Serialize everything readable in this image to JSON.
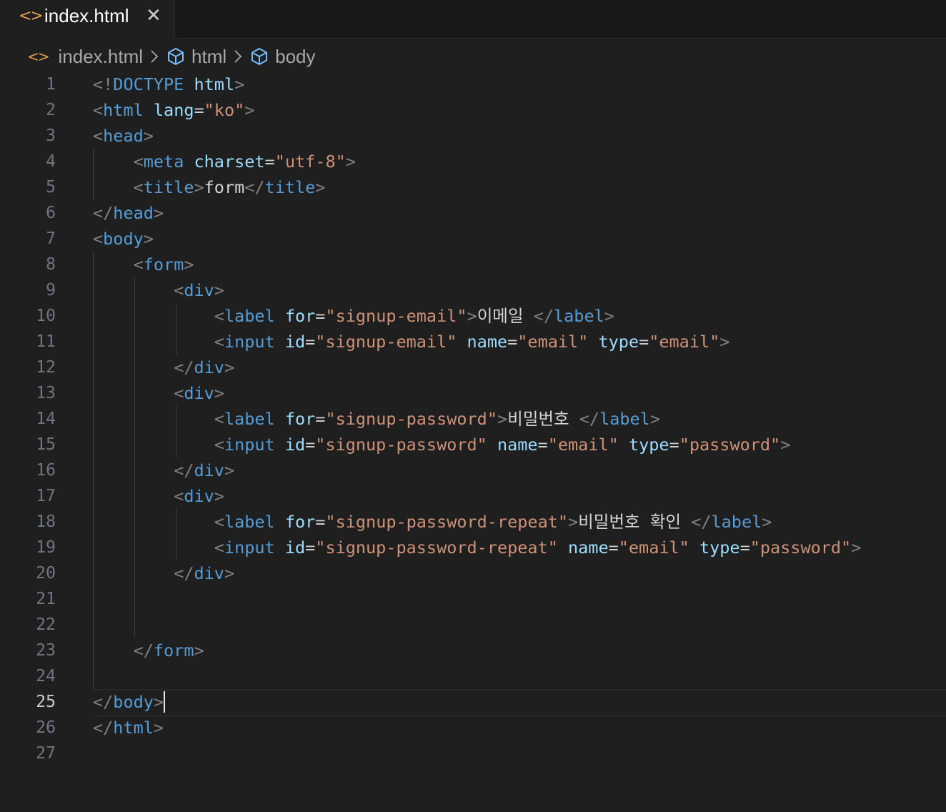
{
  "tab": {
    "label": "index.html",
    "icon": "html-file-icon",
    "close": "✕"
  },
  "breadcrumb": {
    "items": [
      "index.html",
      "html",
      "body"
    ]
  },
  "editor": {
    "active_line": 25,
    "lines": [
      {
        "n": "1",
        "tokens": [
          {
            "t": "p",
            "v": "<!"
          },
          {
            "t": "tag",
            "v": "DOCTYPE"
          },
          {
            "t": "w",
            "v": " "
          },
          {
            "t": "attr",
            "v": "html"
          },
          {
            "t": "p",
            "v": ">"
          }
        ]
      },
      {
        "n": "2",
        "tokens": [
          {
            "t": "p",
            "v": "<"
          },
          {
            "t": "tag",
            "v": "html"
          },
          {
            "t": "w",
            "v": " "
          },
          {
            "t": "attr",
            "v": "lang"
          },
          {
            "t": "eq",
            "v": "="
          },
          {
            "t": "str",
            "v": "\"ko\""
          },
          {
            "t": "p",
            "v": ">"
          }
        ]
      },
      {
        "n": "3",
        "tokens": [
          {
            "t": "p",
            "v": "<"
          },
          {
            "t": "tag",
            "v": "head"
          },
          {
            "t": "p",
            "v": ">"
          }
        ]
      },
      {
        "n": "4",
        "tokens": [
          {
            "t": "w",
            "v": "    "
          },
          {
            "t": "p",
            "v": "<"
          },
          {
            "t": "tag",
            "v": "meta"
          },
          {
            "t": "w",
            "v": " "
          },
          {
            "t": "attr",
            "v": "charset"
          },
          {
            "t": "eq",
            "v": "="
          },
          {
            "t": "str",
            "v": "\"utf-8\""
          },
          {
            "t": "p",
            "v": ">"
          }
        ]
      },
      {
        "n": "5",
        "tokens": [
          {
            "t": "w",
            "v": "    "
          },
          {
            "t": "p",
            "v": "<"
          },
          {
            "t": "tag",
            "v": "title"
          },
          {
            "t": "p",
            "v": ">"
          },
          {
            "t": "text",
            "v": "form"
          },
          {
            "t": "p",
            "v": "</"
          },
          {
            "t": "tag",
            "v": "title"
          },
          {
            "t": "p",
            "v": ">"
          }
        ]
      },
      {
        "n": "6",
        "tokens": [
          {
            "t": "p",
            "v": "</"
          },
          {
            "t": "tag",
            "v": "head"
          },
          {
            "t": "p",
            "v": ">"
          }
        ]
      },
      {
        "n": "7",
        "tokens": [
          {
            "t": "p",
            "v": "<"
          },
          {
            "t": "tag",
            "v": "body"
          },
          {
            "t": "p",
            "v": ">"
          }
        ]
      },
      {
        "n": "8",
        "tokens": [
          {
            "t": "w",
            "v": "    "
          },
          {
            "t": "p",
            "v": "<"
          },
          {
            "t": "tag",
            "v": "form"
          },
          {
            "t": "p",
            "v": ">"
          }
        ]
      },
      {
        "n": "9",
        "tokens": [
          {
            "t": "w",
            "v": "        "
          },
          {
            "t": "p",
            "v": "<"
          },
          {
            "t": "tag",
            "v": "div"
          },
          {
            "t": "p",
            "v": ">"
          }
        ]
      },
      {
        "n": "10",
        "tokens": [
          {
            "t": "w",
            "v": "            "
          },
          {
            "t": "p",
            "v": "<"
          },
          {
            "t": "tag",
            "v": "label"
          },
          {
            "t": "w",
            "v": " "
          },
          {
            "t": "attr",
            "v": "for"
          },
          {
            "t": "eq",
            "v": "="
          },
          {
            "t": "str",
            "v": "\"signup-email\""
          },
          {
            "t": "p",
            "v": ">"
          },
          {
            "t": "text",
            "v": "이메일 "
          },
          {
            "t": "p",
            "v": "</"
          },
          {
            "t": "tag",
            "v": "label"
          },
          {
            "t": "p",
            "v": ">"
          }
        ]
      },
      {
        "n": "11",
        "tokens": [
          {
            "t": "w",
            "v": "            "
          },
          {
            "t": "p",
            "v": "<"
          },
          {
            "t": "tag",
            "v": "input"
          },
          {
            "t": "w",
            "v": " "
          },
          {
            "t": "attr",
            "v": "id"
          },
          {
            "t": "eq",
            "v": "="
          },
          {
            "t": "str",
            "v": "\"signup-email\""
          },
          {
            "t": "w",
            "v": " "
          },
          {
            "t": "attr",
            "v": "name"
          },
          {
            "t": "eq",
            "v": "="
          },
          {
            "t": "str",
            "v": "\"email\""
          },
          {
            "t": "w",
            "v": " "
          },
          {
            "t": "attr",
            "v": "type"
          },
          {
            "t": "eq",
            "v": "="
          },
          {
            "t": "str",
            "v": "\"email\""
          },
          {
            "t": "p",
            "v": ">"
          }
        ]
      },
      {
        "n": "12",
        "tokens": [
          {
            "t": "w",
            "v": "        "
          },
          {
            "t": "p",
            "v": "</"
          },
          {
            "t": "tag",
            "v": "div"
          },
          {
            "t": "p",
            "v": ">"
          }
        ]
      },
      {
        "n": "13",
        "tokens": [
          {
            "t": "w",
            "v": "        "
          },
          {
            "t": "p",
            "v": "<"
          },
          {
            "t": "tag",
            "v": "div"
          },
          {
            "t": "p",
            "v": ">"
          }
        ]
      },
      {
        "n": "14",
        "tokens": [
          {
            "t": "w",
            "v": "            "
          },
          {
            "t": "p",
            "v": "<"
          },
          {
            "t": "tag",
            "v": "label"
          },
          {
            "t": "w",
            "v": " "
          },
          {
            "t": "attr",
            "v": "for"
          },
          {
            "t": "eq",
            "v": "="
          },
          {
            "t": "str",
            "v": "\"signup-password\""
          },
          {
            "t": "p",
            "v": ">"
          },
          {
            "t": "text",
            "v": "비밀번호 "
          },
          {
            "t": "p",
            "v": "</"
          },
          {
            "t": "tag",
            "v": "label"
          },
          {
            "t": "p",
            "v": ">"
          }
        ]
      },
      {
        "n": "15",
        "tokens": [
          {
            "t": "w",
            "v": "            "
          },
          {
            "t": "p",
            "v": "<"
          },
          {
            "t": "tag",
            "v": "input"
          },
          {
            "t": "w",
            "v": " "
          },
          {
            "t": "attr",
            "v": "id"
          },
          {
            "t": "eq",
            "v": "="
          },
          {
            "t": "str",
            "v": "\"signup-password\""
          },
          {
            "t": "w",
            "v": " "
          },
          {
            "t": "attr",
            "v": "name"
          },
          {
            "t": "eq",
            "v": "="
          },
          {
            "t": "str",
            "v": "\"email\""
          },
          {
            "t": "w",
            "v": " "
          },
          {
            "t": "attr",
            "v": "type"
          },
          {
            "t": "eq",
            "v": "="
          },
          {
            "t": "str",
            "v": "\"password\""
          },
          {
            "t": "p",
            "v": ">"
          }
        ]
      },
      {
        "n": "16",
        "tokens": [
          {
            "t": "w",
            "v": "        "
          },
          {
            "t": "p",
            "v": "</"
          },
          {
            "t": "tag",
            "v": "div"
          },
          {
            "t": "p",
            "v": ">"
          }
        ]
      },
      {
        "n": "17",
        "tokens": [
          {
            "t": "w",
            "v": "        "
          },
          {
            "t": "p",
            "v": "<"
          },
          {
            "t": "tag",
            "v": "div"
          },
          {
            "t": "p",
            "v": ">"
          }
        ]
      },
      {
        "n": "18",
        "tokens": [
          {
            "t": "w",
            "v": "            "
          },
          {
            "t": "p",
            "v": "<"
          },
          {
            "t": "tag",
            "v": "label"
          },
          {
            "t": "w",
            "v": " "
          },
          {
            "t": "attr",
            "v": "for"
          },
          {
            "t": "eq",
            "v": "="
          },
          {
            "t": "str",
            "v": "\"signup-password-repeat\""
          },
          {
            "t": "p",
            "v": ">"
          },
          {
            "t": "text",
            "v": "비밀번호 확인 "
          },
          {
            "t": "p",
            "v": "</"
          },
          {
            "t": "tag",
            "v": "label"
          },
          {
            "t": "p",
            "v": ">"
          }
        ]
      },
      {
        "n": "19",
        "tokens": [
          {
            "t": "w",
            "v": "            "
          },
          {
            "t": "p",
            "v": "<"
          },
          {
            "t": "tag",
            "v": "input"
          },
          {
            "t": "w",
            "v": " "
          },
          {
            "t": "attr",
            "v": "id"
          },
          {
            "t": "eq",
            "v": "="
          },
          {
            "t": "str",
            "v": "\"signup-password-repeat\""
          },
          {
            "t": "w",
            "v": " "
          },
          {
            "t": "attr",
            "v": "name"
          },
          {
            "t": "eq",
            "v": "="
          },
          {
            "t": "str",
            "v": "\"email\""
          },
          {
            "t": "w",
            "v": " "
          },
          {
            "t": "attr",
            "v": "type"
          },
          {
            "t": "eq",
            "v": "="
          },
          {
            "t": "str",
            "v": "\"password\""
          },
          {
            "t": "p",
            "v": ">"
          }
        ]
      },
      {
        "n": "20",
        "tokens": [
          {
            "t": "w",
            "v": "        "
          },
          {
            "t": "p",
            "v": "</"
          },
          {
            "t": "tag",
            "v": "div"
          },
          {
            "t": "p",
            "v": ">"
          }
        ]
      },
      {
        "n": "21",
        "tokens": []
      },
      {
        "n": "22",
        "tokens": []
      },
      {
        "n": "23",
        "tokens": [
          {
            "t": "w",
            "v": "    "
          },
          {
            "t": "p",
            "v": "</"
          },
          {
            "t": "tag",
            "v": "form"
          },
          {
            "t": "p",
            "v": ">"
          }
        ]
      },
      {
        "n": "24",
        "tokens": []
      },
      {
        "n": "25",
        "tokens": [
          {
            "t": "p",
            "v": "</"
          },
          {
            "t": "tag",
            "v": "body"
          },
          {
            "t": "p",
            "v": ">"
          }
        ]
      },
      {
        "n": "26",
        "tokens": [
          {
            "t": "p",
            "v": "</"
          },
          {
            "t": "tag",
            "v": "html"
          },
          {
            "t": "p",
            "v": ">"
          }
        ]
      },
      {
        "n": "27",
        "tokens": []
      }
    ]
  },
  "colors": {
    "background": "#1f1f1f",
    "tag": "#569cd6",
    "attribute": "#9cdcfe",
    "string": "#ce9178",
    "punctuation": "#808080",
    "file_icon": "#e2a04a"
  }
}
